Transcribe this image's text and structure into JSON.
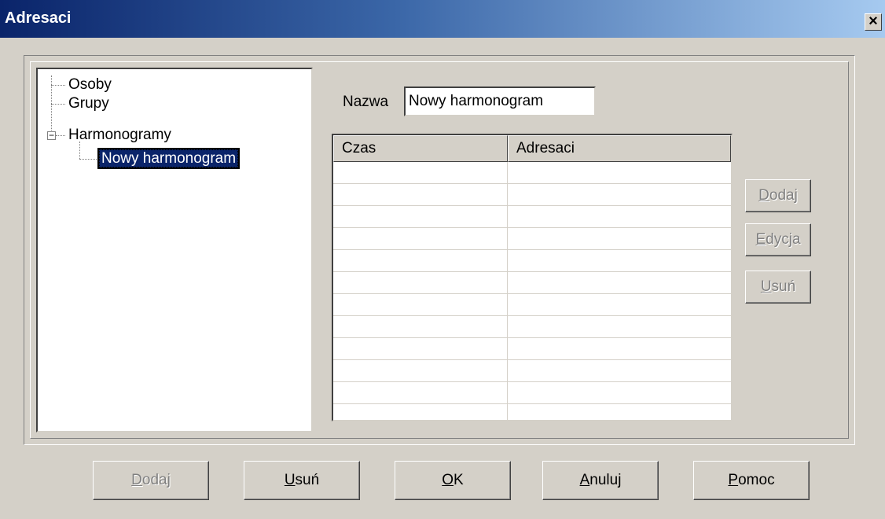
{
  "window": {
    "title": "Adresaci",
    "close_glyph": "×"
  },
  "tree": {
    "items": [
      {
        "label": "Osoby"
      },
      {
        "label": "Grupy"
      },
      {
        "label": "Harmonogramy",
        "expander": "−"
      },
      {
        "label": "Nowy harmonogram",
        "selected": true
      }
    ]
  },
  "form": {
    "name_label": "Nazwa",
    "name_value": "Nowy harmonogram"
  },
  "grid": {
    "columns": [
      "Czas",
      "Adresaci"
    ],
    "rows": [
      [
        "",
        ""
      ],
      [
        "",
        ""
      ],
      [
        "",
        ""
      ],
      [
        "",
        ""
      ],
      [
        "",
        ""
      ],
      [
        "",
        ""
      ],
      [
        "",
        ""
      ],
      [
        "",
        ""
      ],
      [
        "",
        ""
      ],
      [
        "",
        ""
      ],
      [
        "",
        ""
      ],
      [
        "",
        ""
      ]
    ]
  },
  "side_buttons": {
    "add": {
      "mnemonic": "D",
      "rest": "odaj",
      "enabled": false
    },
    "edit": {
      "mnemonic": "E",
      "rest": "dycja",
      "enabled": false
    },
    "remove": {
      "mnemonic": "U",
      "rest": "suń",
      "enabled": false
    }
  },
  "bottom_buttons": {
    "add": {
      "mnemonic": "D",
      "rest": "odaj",
      "enabled": false
    },
    "remove": {
      "mnemonic": "U",
      "rest": "suń",
      "enabled": true
    },
    "ok": {
      "mnemonic": "O",
      "rest": "K",
      "enabled": true
    },
    "cancel": {
      "mnemonic": "A",
      "rest": "nuluj",
      "enabled": true
    },
    "help": {
      "mnemonic": "P",
      "rest": "omoc",
      "enabled": true
    }
  },
  "colors": {
    "titlebar_start": "#0a246a",
    "titlebar_end": "#a6caf0",
    "dialog_face": "#d4d0c8",
    "selection": "#0a246a",
    "disabled_text": "#808080"
  }
}
